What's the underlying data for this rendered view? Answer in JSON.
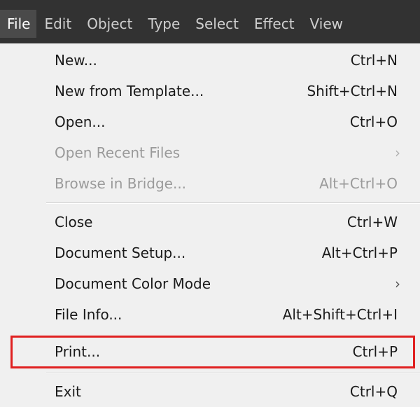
{
  "menubar": {
    "items": [
      {
        "label": "File",
        "active": true
      },
      {
        "label": "Edit"
      },
      {
        "label": "Object"
      },
      {
        "label": "Type"
      },
      {
        "label": "Select"
      },
      {
        "label": "Effect"
      },
      {
        "label": "View"
      }
    ]
  },
  "file_menu": {
    "items": [
      {
        "label": "New...",
        "shortcut": "Ctrl+N"
      },
      {
        "label": "New from Template...",
        "shortcut": "Shift+Ctrl+N"
      },
      {
        "label": "Open...",
        "shortcut": "Ctrl+O"
      },
      {
        "label": "Open Recent Files",
        "submenu_arrow": "›",
        "disabled": true
      },
      {
        "label": "Browse in Bridge...",
        "shortcut": "Alt+Ctrl+O",
        "disabled": true
      },
      {
        "label": "Close",
        "shortcut": "Ctrl+W"
      },
      {
        "label": "Document Setup...",
        "shortcut": "Alt+Ctrl+P"
      },
      {
        "label": "Document Color Mode",
        "submenu_arrow": "›"
      },
      {
        "label": "File Info...",
        "shortcut": "Alt+Shift+Ctrl+I"
      },
      {
        "label": "Print...",
        "shortcut": "Ctrl+P",
        "highlighted": true
      },
      {
        "label": "Exit",
        "shortcut": "Ctrl+Q"
      }
    ]
  },
  "colors": {
    "menubar_bg": "#323232",
    "menu_bg": "#f0f0f0",
    "highlight_border": "#e02020",
    "disabled_text": "#9a9a9a"
  }
}
